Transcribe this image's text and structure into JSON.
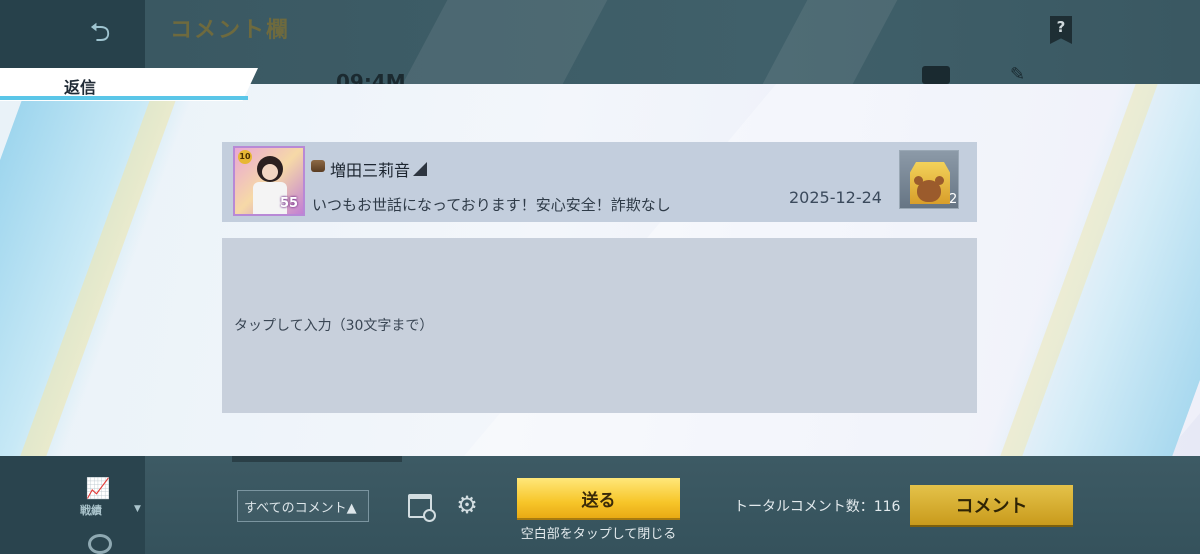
{
  "background": {
    "title": "コメント欄",
    "time_text": "09:4M",
    "help_label": "?",
    "results_label": "戦績"
  },
  "reply_dialog": {
    "tab_label": "返信",
    "comment": {
      "avatar_level": "55",
      "avatar_badge": "10",
      "username": "増田三莉音",
      "text": "いつもお世話になっております！安心安全！詐欺なし",
      "date": "2025-12-24",
      "gift_count": "2"
    },
    "input_placeholder": "タップして入力（30文字まで）"
  },
  "bottom_bar": {
    "filter_label": "すべてのコメント▲",
    "send_label": "送る",
    "close_hint": "空白部をタップして閉じる",
    "total_comments": "トータルコメント数：116",
    "comment_label": "コメント"
  },
  "colors": {
    "accent": "#5ac6e8",
    "send_button": "#f7c62a",
    "comment_button": "#c99b1c"
  }
}
